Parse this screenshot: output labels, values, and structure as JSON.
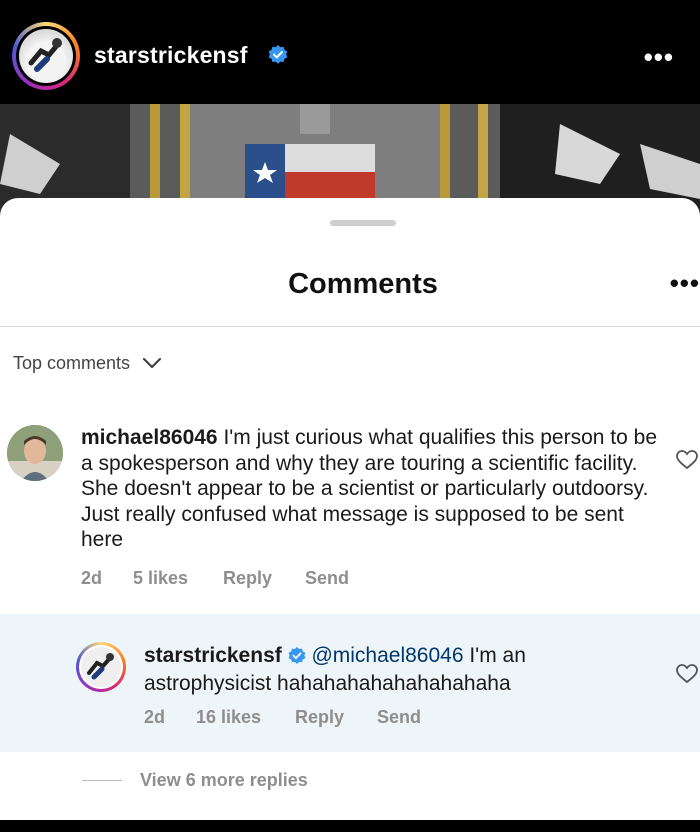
{
  "header": {
    "username": "starstrickensf",
    "more_label": "•••"
  },
  "sheet": {
    "title": "Comments",
    "more_label": "•••",
    "sort_label": "Top comments"
  },
  "comment": {
    "username": "michael86046",
    "text": " I'm just curious what qualifies this person to be a spokesperson and why they are touring a scientific facility. She doesn't appear to be a scientist or particularly outdoorsy.  Just really confused what message is supposed to be sent here",
    "time": "2d",
    "likes": "5 likes",
    "reply_label": "Reply",
    "send_label": "Send"
  },
  "reply": {
    "username": "starstrickensf",
    "mention": "@michael86046",
    "text": " I'm an astrophysicist hahahahahahahahahaha",
    "time": "2d",
    "likes": "16 likes",
    "reply_label": "Reply",
    "send_label": "Send"
  },
  "view_more": "View 6 more replies",
  "colors": {
    "verified": "#3897f0",
    "mention": "#00376b",
    "meta": "#8e8e8e",
    "reply_bg": "#eef5f8"
  }
}
